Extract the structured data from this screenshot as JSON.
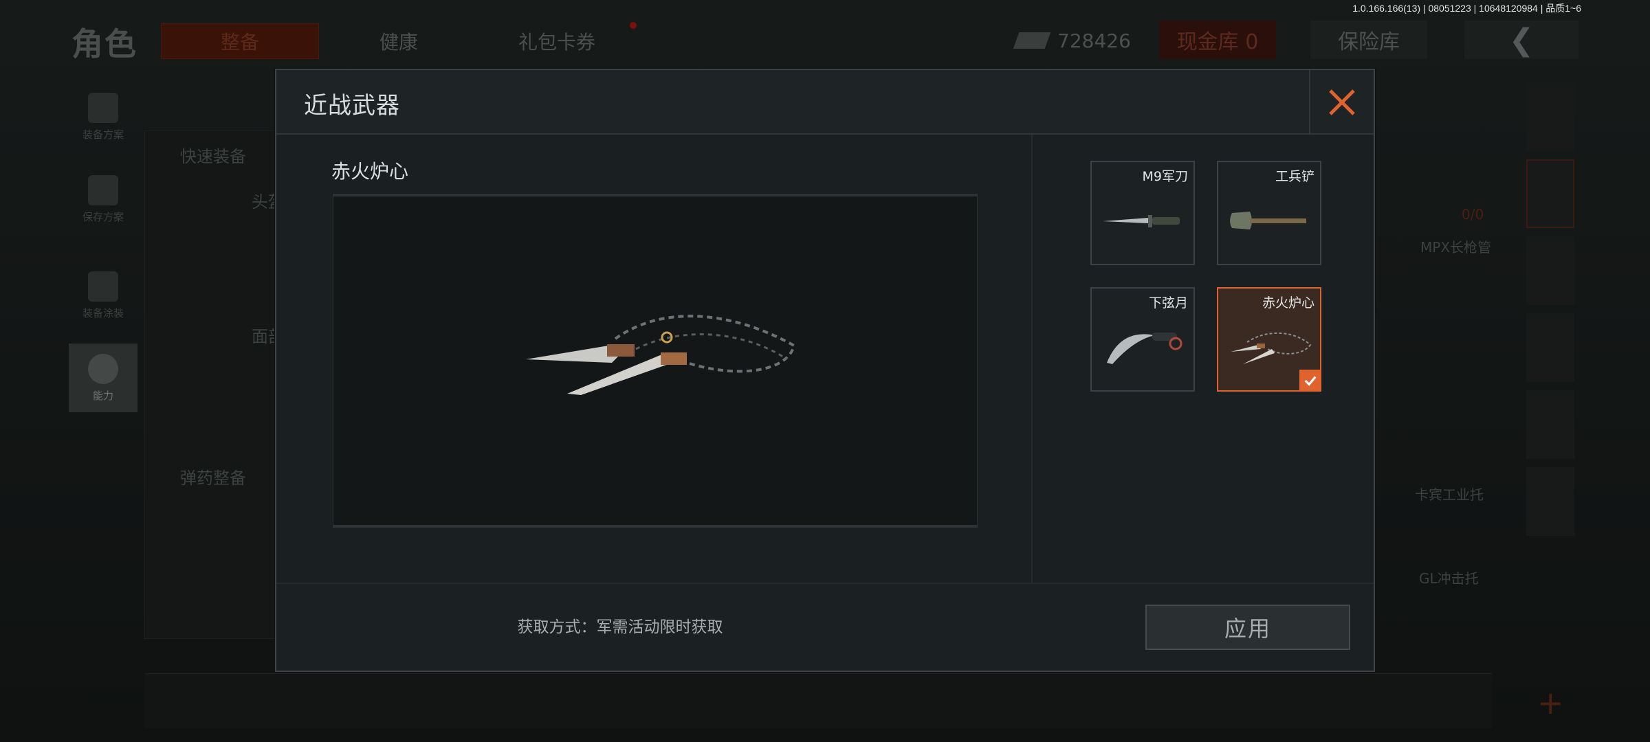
{
  "version_info": "1.0.166.166(13) | 08051223 | 10648120984 | 品质1~6",
  "background": {
    "title": "角色",
    "tabs": [
      {
        "label": "整备"
      },
      {
        "label": "健康"
      },
      {
        "label": "礼包卡券"
      }
    ],
    "money": "728426",
    "cash_vault": "现金库 0",
    "safe_box": "保险库",
    "back_glyph": "❮",
    "left_nav": [
      {
        "label": "装备方案"
      },
      {
        "label": "保存方案"
      },
      {
        "label": "装备涂装"
      },
      {
        "label": "能力"
      }
    ],
    "labels": {
      "quick_equip": "快速装备",
      "head": "头盔",
      "face": "面部",
      "ammo": "弹药整备",
      "mpx_barrel": "MPX长枪管",
      "card_stock": "卡宾工业托",
      "gl_stock": "GL冲击托",
      "zero": "0/0"
    }
  },
  "modal": {
    "title": "近战武器",
    "preview_name": "赤火炉心",
    "weapons": [
      {
        "name": "M9军刀",
        "icon": "bayonet-icon",
        "selected": false
      },
      {
        "name": "工兵铲",
        "icon": "shovel-icon",
        "selected": false
      },
      {
        "name": "下弦月",
        "icon": "karambit-icon",
        "selected": false
      },
      {
        "name": "赤火炉心",
        "icon": "chain-blades-icon",
        "selected": true
      }
    ],
    "obtain_text": "获取方式：军需活动限时获取",
    "apply_label": "应用",
    "accent_color": "#e0622d"
  }
}
